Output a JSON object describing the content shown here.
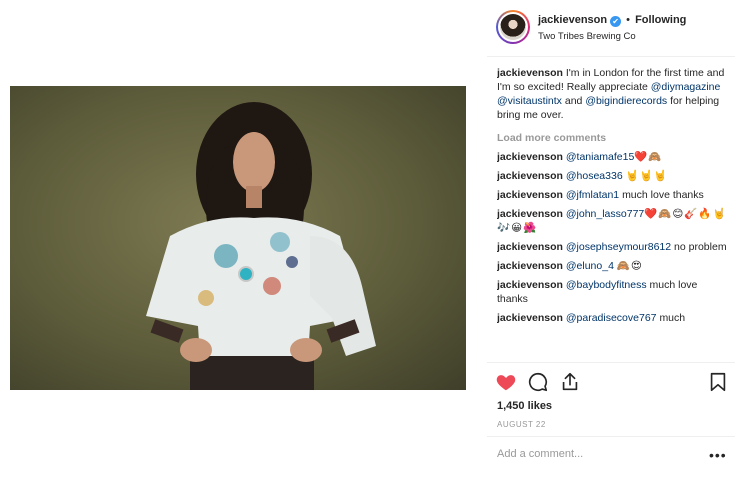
{
  "post": {
    "username": "jackievenson",
    "verified_glyph": "✔",
    "separator": "•",
    "follow_label": "Following",
    "location": "Two Tribes Brewing Co",
    "likes": "1,450 likes",
    "date": "AUGUST 22"
  },
  "caption": {
    "username": "jackievenson",
    "text_1": "I'm in London for the first time and I'm so excited! Really appreciate",
    "mention_1": "@diymagazine",
    "mention_2": "@visitaustintx",
    "text_2": "and",
    "mention_3": "@bigindierecords",
    "text_3": "for helping bring me over."
  },
  "load_more": "Load more comments",
  "comments": [
    {
      "user": "jackievenson",
      "mention": "@taniamafe15",
      "text": "",
      "emoji": "❤️🙈"
    },
    {
      "user": "jackievenson",
      "mention": "@hosea336",
      "text": "",
      "emoji": "🤘🤘🤘"
    },
    {
      "user": "jackievenson",
      "mention": "@jfmlatan1",
      "text": "much love thanks",
      "emoji": ""
    },
    {
      "user": "jackievenson",
      "mention": "@john_lasso777",
      "text": "",
      "emoji": "❤️🙈😊🎸🔥🤘🎶😀🌺"
    },
    {
      "user": "jackievenson",
      "mention": "@josephseymour8612",
      "text": "no problem",
      "emoji": ""
    },
    {
      "user": "jackievenson",
      "mention": "@eluno_4",
      "text": "",
      "emoji": "🙈😍"
    },
    {
      "user": "jackievenson",
      "mention": "@baybodyfitness",
      "text": "much love thanks",
      "emoji": ""
    },
    {
      "user": "jackievenson",
      "mention": "@paradisecove767",
      "text": "much",
      "emoji": ""
    }
  ],
  "add_comment": {
    "placeholder": "Add a comment...",
    "value": ""
  },
  "more_options": "•••",
  "colors": {
    "like_red": "#ed4956",
    "link_blue": "#003569",
    "verified_blue": "#3897f0",
    "muted_gray": "#999999"
  },
  "icons": [
    "heart-icon",
    "comment-icon",
    "share-icon",
    "bookmark-icon",
    "verified-icon"
  ]
}
